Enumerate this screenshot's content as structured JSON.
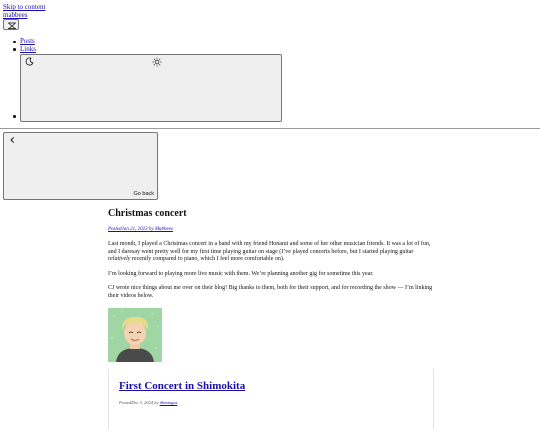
{
  "header": {
    "skip_link": "Skip to content",
    "site_title": "mabbees",
    "menu_icon": "hamburger-close-icon"
  },
  "nav": {
    "items": [
      {
        "label": "Posts"
      },
      {
        "label": "Links"
      }
    ],
    "theme_toggle": {
      "dark_icon": "moon-icon",
      "light_icon": "sun-icon"
    }
  },
  "back_button": {
    "label": "Go back",
    "icon": "chevron-left-icon"
  },
  "post": {
    "title": "Christmas concert",
    "meta_prefix": "Posted",
    "date": "Jan 21, 2023",
    "by": " by ",
    "author": "Mabbees",
    "p1_a": "Last month, I played a Christmas concert in a band with my friend Honami and some of her other musician friends. It was a lot of fun, and I daresay went pretty well for my first time playing guitar on stage (I’ve played concerts before, but I started playing guitar ",
    "p1_em": "relatively",
    "p1_b": " recently compared to piano, which I feel more comfortable on).",
    "p2": "I’m looking forward to playing more live music with them. We’re planning another gig for sometime this year.",
    "p3": "CJ wrote nice things about me over on their blog! Big thanks to them, both for their support, and for recording the show — I’m linking their videos below."
  },
  "embed": {
    "title": "First Concert in Shimokita",
    "meta_prefix": "Posted",
    "date": "Dec 3, 2024",
    "by": " by ",
    "author": "tlbmingus"
  },
  "colors": {
    "link": "#1a0dab",
    "avatar_bg": "#9fd6a3",
    "hair": "#e8dc8a"
  }
}
